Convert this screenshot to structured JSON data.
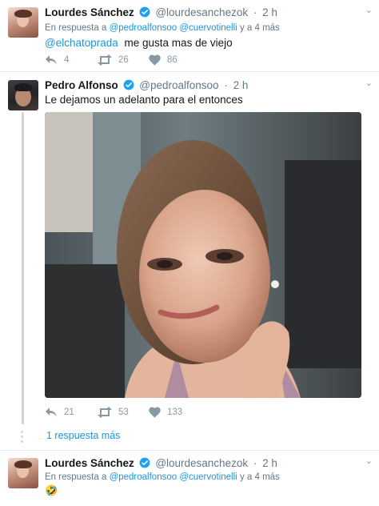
{
  "tweets": [
    {
      "name": "Lourdes Sánchez",
      "handle": "@lourdesanchezok",
      "time": "2 h",
      "reply_prefix": "En respuesta a",
      "reply_users": "@pedroalfonsoo @cuervotinelli",
      "reply_suffix": "y a 4 más",
      "mention": "@elchatoprada",
      "text": "me gusta mas de viejo",
      "replies": "4",
      "retweets": "26",
      "likes": "86"
    },
    {
      "name": "Pedro Alfonso",
      "handle": "@pedroalfonsoo",
      "time": "2 h",
      "text": "Le dejamos un adelanto para el entonces",
      "replies": "21",
      "retweets": "53",
      "likes": "133"
    },
    {
      "name": "Lourdes Sánchez",
      "handle": "@lourdesanchezok",
      "time": "2 h",
      "reply_prefix": "En respuesta a",
      "reply_users": "@pedroalfonsoo @cuervotinelli",
      "reply_suffix": "y a 4 más",
      "emoji": "🤣"
    }
  ],
  "more_replies": "1 respuesta más",
  "separator": "·",
  "caret": "⌄",
  "icons": [
    "verified-icon",
    "reply-icon",
    "retweet-icon",
    "like-icon",
    "caret-down-icon"
  ],
  "colors": {
    "link": "#1b95e0",
    "muted": "#657786",
    "verified": "#1da1f2",
    "thread": "#ccd6dd"
  }
}
